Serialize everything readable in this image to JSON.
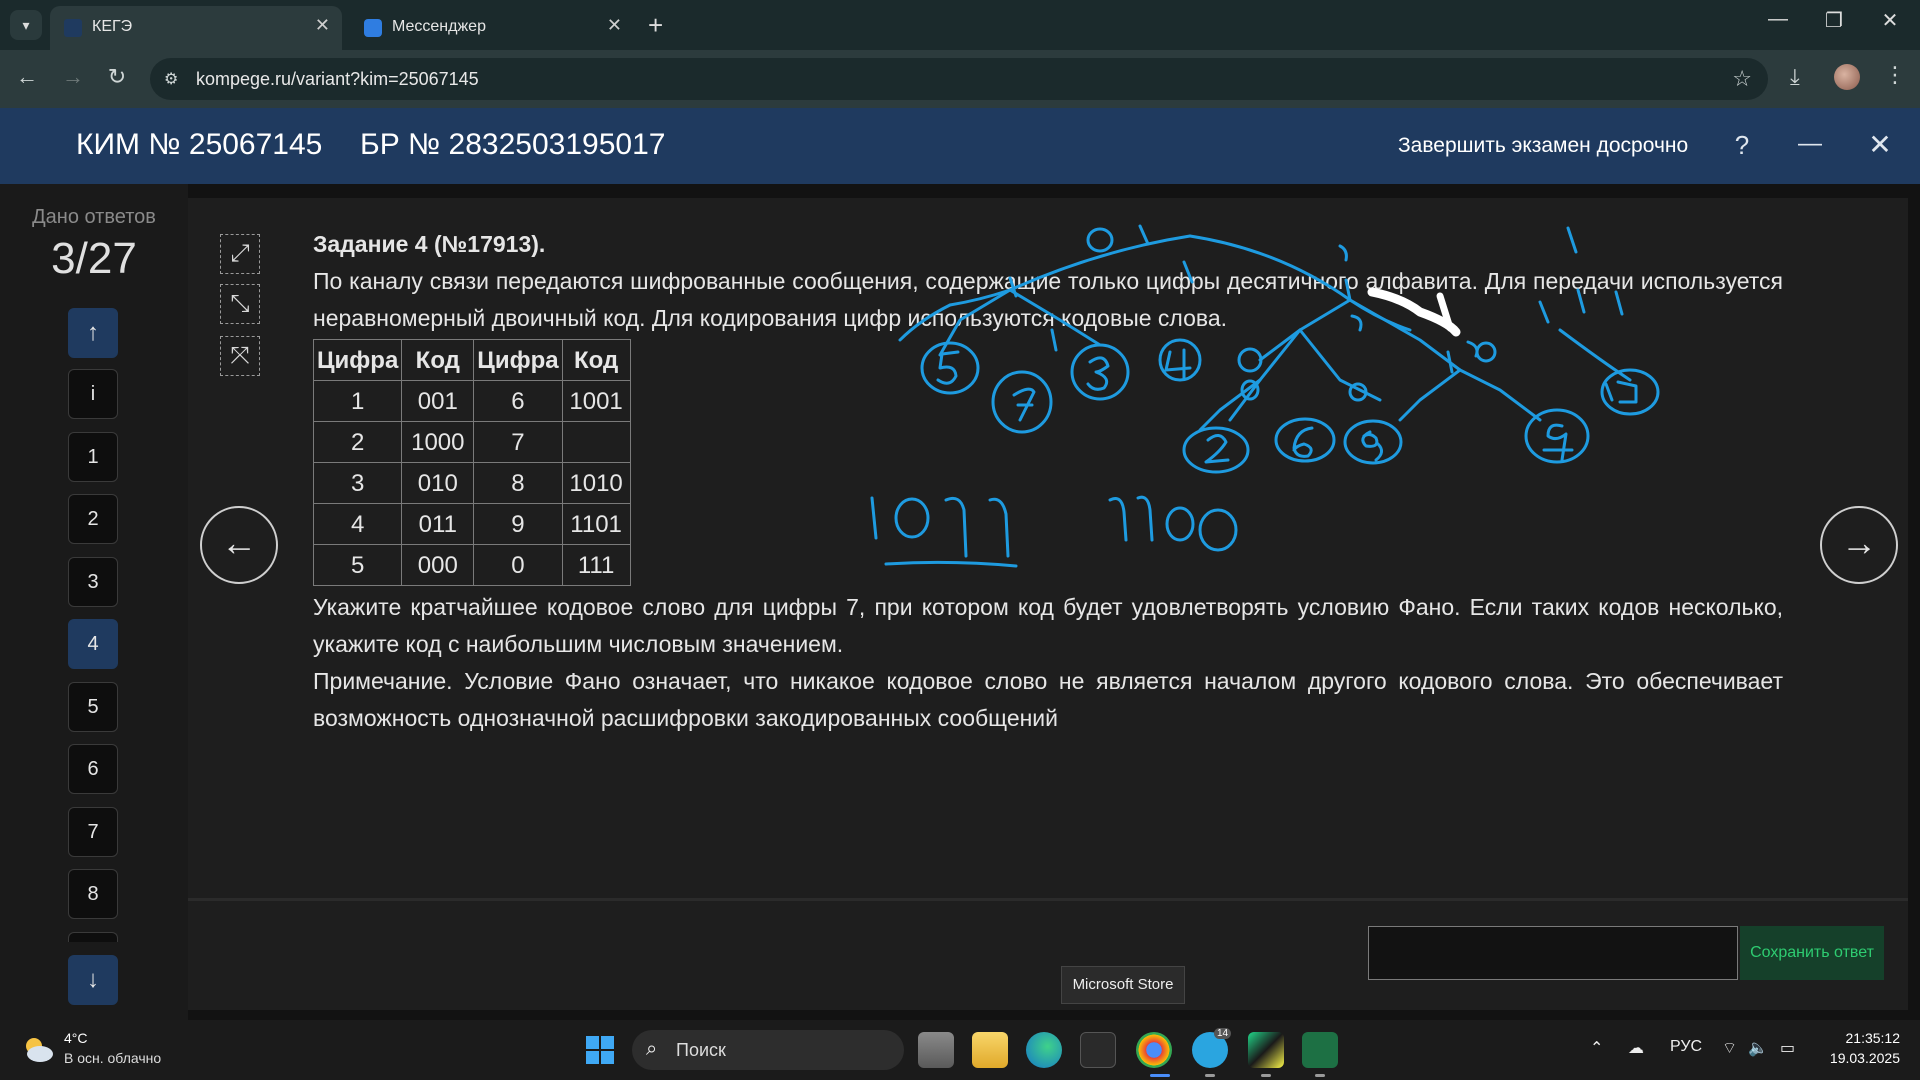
{
  "browser": {
    "tabs": [
      {
        "title": "КЕГЭ"
      },
      {
        "title": "Мессенджер"
      }
    ],
    "url": "kompege.ru/variant?kim=25067145"
  },
  "header": {
    "kim": "КИМ № 25067145",
    "br": "БР № 2832503195017",
    "finish_label": "Завершить экзамен досрочно",
    "help_glyph": "?",
    "minimize_glyph": "—",
    "close_glyph": "✕"
  },
  "sidebar": {
    "answered_label": "Дано ответов",
    "answered_count": "3/27",
    "up_glyph": "↑",
    "down_glyph": "↓",
    "items": [
      {
        "label": "i"
      },
      {
        "label": "1"
      },
      {
        "label": "2"
      },
      {
        "label": "3"
      },
      {
        "label": "4"
      },
      {
        "label": "5"
      },
      {
        "label": "6"
      },
      {
        "label": "7"
      },
      {
        "label": "8"
      }
    ],
    "current": "4"
  },
  "task": {
    "title": "Задание 4 (№17913).",
    "intro": "По каналу связи передаются шифрованные сообщения, содержащие только цифры десятичного алфавита. Для передачи используется неравномерный двоичный код. Для кодирования цифр используются кодовые слова.",
    "table": {
      "headers": [
        "Цифра",
        "Код",
        "Цифра",
        "Код"
      ],
      "rows": [
        [
          "1",
          "001",
          "6",
          "1001"
        ],
        [
          "2",
          "1000",
          "7",
          ""
        ],
        [
          "3",
          "010",
          "8",
          "1010"
        ],
        [
          "4",
          "011",
          "9",
          "1101"
        ],
        [
          "5",
          "000",
          "0",
          "111"
        ]
      ]
    },
    "question": "Укажите кратчайшее кодовое слово для цифры 7, при котором код будет удовлетворять условию Фано. Если таких кодов несколько, укажите код с наибольшим числовым значением.",
    "note": "Примечание. Условие Фано означает, что никакое кодовое слово не является началом другого кодового слова. Это обеспечивает возможность однозначной расшифровки закодированных сообщений"
  },
  "navigation": {
    "prev_glyph": "←",
    "next_glyph": "→"
  },
  "answer": {
    "value": "",
    "save_label": "Сохранить ответ"
  },
  "tooltip": "Microsoft Store",
  "taskbar": {
    "weather_temp": "4°C",
    "weather_desc": "В осн. облачно",
    "search_placeholder": "Поиск",
    "telegram_badge": "14",
    "lang": "РУС",
    "time": "21:35:12",
    "date": "19.03.2025"
  },
  "colors": {
    "header": "#1f3a5f",
    "ink": "#1e9be0",
    "save_text": "#2ecc71"
  }
}
